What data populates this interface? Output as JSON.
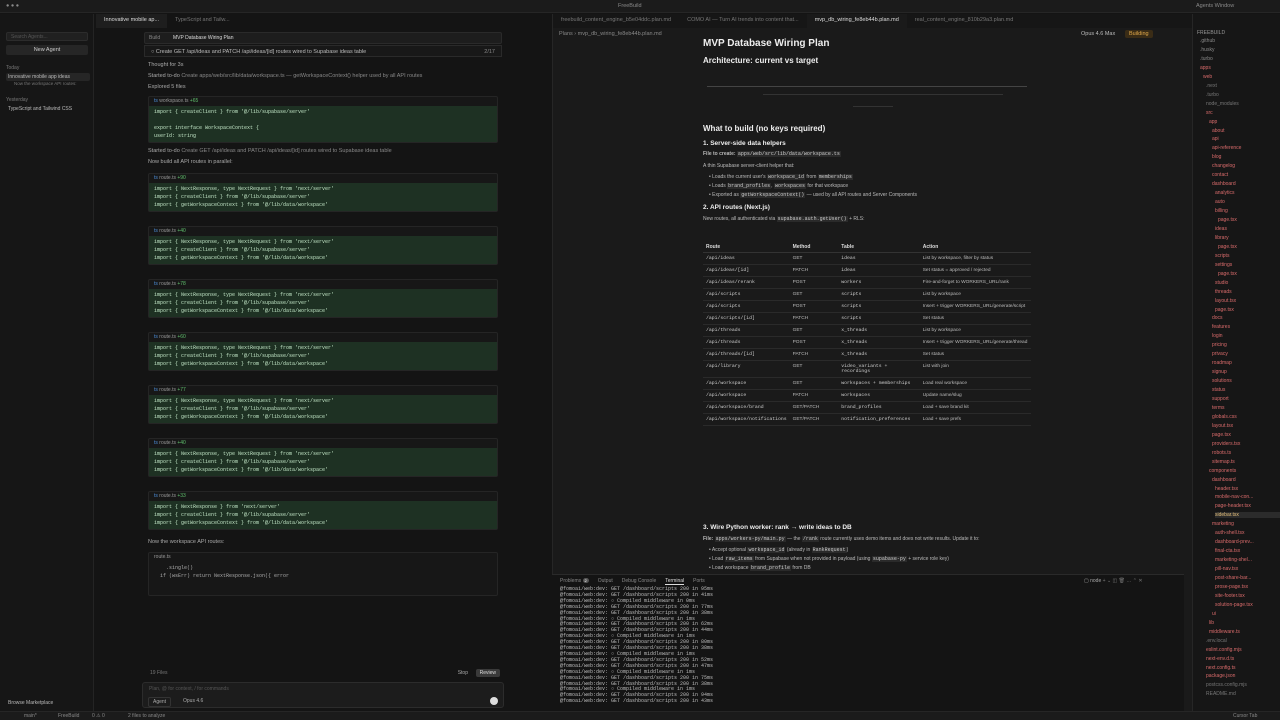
{
  "window": {
    "title": "FreeBuild",
    "right_title": "Agents Window"
  },
  "chat_tabs": [
    {
      "label": "Innovative mobile ap..."
    },
    {
      "label": "TypeScript and Tailw..."
    }
  ],
  "sidebar": {
    "search_placeholder": "Search Agents...",
    "new_agent": "New Agent",
    "today": "Today",
    "item_today": "Innovative mobile app ideas",
    "item_today_sub": "Now the workspace API routes:",
    "yesterday": "Yesterday",
    "item_yesterday": "TypeScript and Tailwind CSS",
    "browse": "Browse Marketplace"
  },
  "chat": {
    "build_label": "Build",
    "plan_title": "MVP Database Wiring Plan",
    "todo_text": "Create GET /api/ideas and PATCH /api/ideas/[id] routes wired to Supabase ideas table",
    "todo_count": "2/17",
    "thought": "Thought for 3s",
    "started1_a": "Started to-do",
    "started1_b": "Create apps/web/src/lib/data/workspace.ts — getWorkspaceContext() helper used by all API routes",
    "explored": "Explored 5 files",
    "started2_a": "Started to-do",
    "started2_b": "Create GET /api/ideas and PATCH /api/ideas/[id] routes wired to Supabase ideas table",
    "parallel": "Now build all API routes in parallel:",
    "workspace_api": "Now the workspace API routes:",
    "files_count": "19 Files",
    "stop": "Stop",
    "review": "Review",
    "composer_placeholder": "Plan, @ for context, / for commands",
    "agent": "Agent",
    "model": "Opus 4.6"
  },
  "cards": [
    {
      "file": "workspace.ts",
      "add": "+65",
      "lines": [
        "import { createClient } from '@/lib/supabase/server'",
        "",
        "export interface WorkspaceContext {",
        "  userId: string"
      ]
    },
    {
      "file": "route.ts",
      "add": "+90",
      "lines": [
        "import { NextResponse, type NextRequest } from 'next/server'",
        "import { createClient } from '@/lib/supabase/server'",
        "import { getWorkspaceContext } from '@/lib/data/workspace'"
      ]
    },
    {
      "file": "route.ts",
      "add": "+40",
      "lines": [
        "import { NextResponse, type NextRequest } from 'next/server'",
        "import { createClient } from '@/lib/supabase/server'",
        "import { getWorkspaceContext } from '@/lib/data/workspace'"
      ]
    },
    {
      "file": "route.ts",
      "add": "+78",
      "lines": [
        "import { NextResponse, type NextRequest } from 'next/server'",
        "import { createClient } from '@/lib/supabase/server'",
        "import { getWorkspaceContext } from '@/lib/data/workspace'"
      ]
    },
    {
      "file": "route.ts",
      "add": "+60",
      "lines": [
        "import { NextResponse, type NextRequest } from 'next/server'",
        "import { createClient } from '@/lib/supabase/server'",
        "import { getWorkspaceContext } from '@/lib/data/workspace'"
      ]
    },
    {
      "file": "route.ts",
      "add": "+77",
      "lines": [
        "import { NextResponse, type NextRequest } from 'next/server'",
        "import { createClient } from '@/lib/supabase/server'",
        "import { getWorkspaceContext } from '@/lib/data/workspace'"
      ]
    },
    {
      "file": "route.ts",
      "add": "+40",
      "lines": [
        "import { NextResponse, type NextRequest } from 'next/server'",
        "import { createClient } from '@/lib/supabase/server'",
        "import { getWorkspaceContext } from '@/lib/data/workspace'"
      ]
    },
    {
      "file": "route.ts",
      "add": "+33",
      "lines": [
        "import { NextResponse } from 'next/server'",
        "import { createClient } from '@/lib/supabase/server'",
        "import { getWorkspaceContext } from '@/lib/data/workspace'"
      ]
    }
  ],
  "last_card": {
    "file": "route.ts",
    "lines": [
      "    .single()",
      "",
      "  if (wsErr) return NextResponse.json({ error"
    ]
  },
  "editor": {
    "tabs": [
      {
        "label": "freebuild_content_engine_b5e04ddc.plan.md"
      },
      {
        "label": "COMO AI — Turn AI trends into content that..."
      },
      {
        "label": "mvp_db_wiring_fe8eb44b.plan.md"
      },
      {
        "label": "real_content_engine_810b29a3.plan.md"
      }
    ],
    "crumb": "Plans  ›  mvp_db_wiring_fe8eb44b.plan.md",
    "model": "Opus 4.6 Max",
    "status": "Building",
    "title": "MVP Database Wiring Plan",
    "h_arch": "Architecture: current vs target",
    "h_build": "What to build (no keys required)",
    "h_1": "1. Server-side data helpers",
    "create_label": "File to create:",
    "create_file": "apps/web/src/lib/data/workspace.ts",
    "thin": "A thin Supabase server-client helper that:",
    "b1a": "Loads the current user's",
    "b1b": "workspace_id",
    "b1c": "from",
    "b1d": "memberships",
    "b2a": "Loads",
    "b2b": "brand_profiles",
    "b2c": ",",
    "b2d": "workspaces",
    "b2e": "for that workspace",
    "b3a": "Exported as",
    "b3b": "getWorkspaceContext()",
    "b3c": "— used by all API routes and Server Components",
    "h_2": "2. API routes (Next.js)",
    "routes_intro_a": "New routes, all authenticated via",
    "routes_intro_b": "supabase.auth.getUser()",
    "routes_intro_c": "+ RLS:",
    "table_headers": [
      "Route",
      "Method",
      "Table",
      "Action"
    ],
    "routes": [
      [
        "/api/ideas",
        "GET",
        "ideas",
        "List by workspace, filter by status"
      ],
      [
        "/api/ideas/[id]",
        "PATCH",
        "ideas",
        "Set status = approved / rejected"
      ],
      [
        "/api/ideas/rerank",
        "POST",
        "workers",
        "Fire-and-forget to WORKERS_URL/rank"
      ],
      [
        "/api/scripts",
        "GET",
        "scripts",
        "List by workspace"
      ],
      [
        "/api/scripts",
        "POST",
        "scripts",
        "Insert + trigger WORKERS_URL/generate/script"
      ],
      [
        "/api/scripts/[id]",
        "PATCH",
        "scripts",
        "Set status"
      ],
      [
        "/api/threads",
        "GET",
        "x_threads",
        "List by workspace"
      ],
      [
        "/api/threads",
        "POST",
        "x_threads",
        "Insert + trigger WORKERS_URL/generate/thread"
      ],
      [
        "/api/threads/[id]",
        "PATCH",
        "x_threads",
        "Set status"
      ],
      [
        "/api/library",
        "GET",
        "video_variants + recordings",
        "List with join"
      ],
      [
        "/api/workspace",
        "GET",
        "workspaces + memberships",
        "Load real workspace"
      ],
      [
        "/api/workspace",
        "PATCH",
        "workspaces",
        "Update name/slug"
      ],
      [
        "/api/workspace/brand",
        "GET/PATCH",
        "brand_profiles",
        "Load + save brand kit"
      ],
      [
        "/api/workspace/notifications",
        "GET/PATCH",
        "notification_preferences",
        "Load + save prefs"
      ]
    ],
    "h_3": "3. Wire Python worker: rank → write ideas to DB",
    "file_label": "File:",
    "file_path": "apps/workers-py/main.py",
    "file_desc_a": "— the",
    "file_desc_b": "/rank",
    "file_desc_c": "route currently uses demo items and does not write results. Update it to:",
    "w1a": "Accept optional",
    "w1b": "workspace_id",
    "w1c": "(already in",
    "w1d": "RankRequest",
    ")": ")",
    "w2a": "Load",
    "w2b": "raw_items",
    "w2c": "from Supabase when not provided in payload (using",
    "w2d": "supabase-py",
    "w2e": "+ service role key)",
    "w3a": "Load workspace",
    "w3b": "brand_profile",
    "w3c": "from DB"
  },
  "terminal": {
    "tabs": [
      "Problems",
      "Output",
      "Debug Console",
      "Terminal",
      "Ports"
    ],
    "problems_count": "2",
    "shell": "node",
    "lines": [
      "@fomoai/web:dev:  GET /dashboard/scripts 200 in 95ms",
      "@fomoai/web:dev:  GET /dashboard/scripts 200 in 41ms",
      "@fomoai/web:dev:  ○ Compiled middleware in 0ms",
      "@fomoai/web:dev:  GET /dashboard/scripts 200 in 77ms",
      "@fomoai/web:dev:  GET /dashboard/scripts 200 in 38ms",
      "@fomoai/web:dev:  ○ Compiled middleware in 1ms",
      "@fomoai/web:dev:  GET /dashboard/scripts 200 in 62ms",
      "@fomoai/web:dev:  GET /dashboard/scripts 200 in 44ms",
      "@fomoai/web:dev:  ○ Compiled middleware in 1ms",
      "@fomoai/web:dev:  GET /dashboard/scripts 200 in 80ms",
      "@fomoai/web:dev:  GET /dashboard/scripts 200 in 38ms",
      "@fomoai/web:dev:  ○ Compiled middleware in 1ms",
      "@fomoai/web:dev:  GET /dashboard/scripts 200 in 52ms",
      "@fomoai/web:dev:  GET /dashboard/scripts 200 in 47ms",
      "@fomoai/web:dev:  ○ Compiled middleware in 1ms",
      "@fomoai/web:dev:  GET /dashboard/scripts 200 in 75ms",
      "@fomoai/web:dev:  GET /dashboard/scripts 200 in 38ms",
      "@fomoai/web:dev:  ○ Compiled middleware in 1ms",
      "@fomoai/web:dev:  GET /dashboard/scripts 200 in 94ms",
      "@fomoai/web:dev:  GET /dashboard/scripts 200 in 43ms"
    ]
  },
  "explorer": {
    "root": "FREEBUILD",
    "items": [
      {
        "n": ".github",
        "d": 1,
        "c": "#8a8a8a"
      },
      {
        "n": ".husky",
        "d": 1,
        "c": "#8a8a8a"
      },
      {
        "n": ".turbo",
        "d": 1,
        "c": "#8a8a8a"
      },
      {
        "n": "apps",
        "d": 1,
        "c": "#d96b6b"
      },
      {
        "n": "web",
        "d": 2,
        "c": "#d96b6b"
      },
      {
        "n": ".next",
        "d": 3,
        "c": "#777"
      },
      {
        "n": ".turbo",
        "d": 3,
        "c": "#777"
      },
      {
        "n": "node_modules",
        "d": 3,
        "c": "#777"
      },
      {
        "n": "src",
        "d": 3,
        "c": "#d96b6b"
      },
      {
        "n": "app",
        "d": 4,
        "c": "#d96b6b"
      },
      {
        "n": "about",
        "d": 5,
        "c": "#d96b6b"
      },
      {
        "n": "api",
        "d": 5,
        "c": "#d96b6b"
      },
      {
        "n": "api-reference",
        "d": 5,
        "c": "#d96b6b"
      },
      {
        "n": "blog",
        "d": 5,
        "c": "#d96b6b"
      },
      {
        "n": "changelog",
        "d": 5,
        "c": "#d96b6b"
      },
      {
        "n": "contact",
        "d": 5,
        "c": "#d96b6b"
      },
      {
        "n": "dashboard",
        "d": 5,
        "c": "#d96b6b"
      },
      {
        "n": "analytics",
        "d": 6,
        "c": "#d96b6b"
      },
      {
        "n": "auto",
        "d": 6,
        "c": "#d96b6b"
      },
      {
        "n": "billing",
        "d": 6,
        "c": "#d96b6b"
      },
      {
        "n": "page.tsx",
        "d": 7,
        "c": "#d96b6b"
      },
      {
        "n": "ideas",
        "d": 6,
        "c": "#d96b6b"
      },
      {
        "n": "library",
        "d": 6,
        "c": "#d96b6b"
      },
      {
        "n": "page.tsx",
        "d": 7,
        "c": "#d96b6b"
      },
      {
        "n": "scripts",
        "d": 6,
        "c": "#d96b6b"
      },
      {
        "n": "settings",
        "d": 6,
        "c": "#d96b6b"
      },
      {
        "n": "page.tsx",
        "d": 7,
        "c": "#d96b6b"
      },
      {
        "n": "studio",
        "d": 6,
        "c": "#d96b6b"
      },
      {
        "n": "threads",
        "d": 6,
        "c": "#d96b6b"
      },
      {
        "n": "layout.tsx",
        "d": 6,
        "c": "#d96b6b"
      },
      {
        "n": "page.tsx",
        "d": 6,
        "c": "#d96b6b"
      },
      {
        "n": "docs",
        "d": 5,
        "c": "#d96b6b"
      },
      {
        "n": "features",
        "d": 5,
        "c": "#d96b6b"
      },
      {
        "n": "login",
        "d": 5,
        "c": "#d96b6b"
      },
      {
        "n": "pricing",
        "d": 5,
        "c": "#d96b6b"
      },
      {
        "n": "privacy",
        "d": 5,
        "c": "#d96b6b"
      },
      {
        "n": "roadmap",
        "d": 5,
        "c": "#d96b6b"
      },
      {
        "n": "signup",
        "d": 5,
        "c": "#d96b6b"
      },
      {
        "n": "solutions",
        "d": 5,
        "c": "#d96b6b"
      },
      {
        "n": "status",
        "d": 5,
        "c": "#d96b6b"
      },
      {
        "n": "support",
        "d": 5,
        "c": "#d96b6b"
      },
      {
        "n": "terms",
        "d": 5,
        "c": "#d96b6b"
      },
      {
        "n": "globals.css",
        "d": 5,
        "c": "#d96b6b"
      },
      {
        "n": "layout.tsx",
        "d": 5,
        "c": "#d96b6b"
      },
      {
        "n": "page.tsx",
        "d": 5,
        "c": "#d96b6b"
      },
      {
        "n": "providers.tsx",
        "d": 5,
        "c": "#d96b6b"
      },
      {
        "n": "robots.ts",
        "d": 5,
        "c": "#d96b6b"
      },
      {
        "n": "sitemap.ts",
        "d": 5,
        "c": "#d96b6b"
      },
      {
        "n": "components",
        "d": 4,
        "c": "#d96b6b"
      },
      {
        "n": "dashboard",
        "d": 5,
        "c": "#d96b6b"
      },
      {
        "n": "header.tsx",
        "d": 6,
        "c": "#d96b6b"
      },
      {
        "n": "mobile-nav-con...",
        "d": 6,
        "c": "#d96b6b"
      },
      {
        "n": "page-header.tsx",
        "d": 6,
        "c": "#d96b6b"
      },
      {
        "n": "sidebar.tsx",
        "d": 6,
        "c": "#e6c07b",
        "sel": true
      },
      {
        "n": "marketing",
        "d": 5,
        "c": "#d96b6b"
      },
      {
        "n": "auth-shell.tsx",
        "d": 6,
        "c": "#d96b6b"
      },
      {
        "n": "dashboard-prev...",
        "d": 6,
        "c": "#d96b6b"
      },
      {
        "n": "final-cta.tsx",
        "d": 6,
        "c": "#d96b6b"
      },
      {
        "n": "marketing-shel...",
        "d": 6,
        "c": "#d96b6b"
      },
      {
        "n": "pill-nav.tsx",
        "d": 6,
        "c": "#d96b6b"
      },
      {
        "n": "post-share-bar...",
        "d": 6,
        "c": "#d96b6b"
      },
      {
        "n": "prose-page.tsx",
        "d": 6,
        "c": "#d96b6b"
      },
      {
        "n": "site-footer.tsx",
        "d": 6,
        "c": "#d96b6b"
      },
      {
        "n": "solution-page.tsx",
        "d": 6,
        "c": "#d96b6b"
      },
      {
        "n": "ui",
        "d": 5,
        "c": "#d96b6b"
      },
      {
        "n": "lib",
        "d": 4,
        "c": "#d96b6b"
      },
      {
        "n": "middleware.ts",
        "d": 4,
        "c": "#d96b6b"
      },
      {
        "n": ".env.local",
        "d": 3,
        "c": "#777"
      },
      {
        "n": "eslint.config.mjs",
        "d": 3,
        "c": "#d96b6b"
      },
      {
        "n": "next-env.d.ts",
        "d": 3,
        "c": "#d96b6b"
      },
      {
        "n": "next.config.ts",
        "d": 3,
        "c": "#d96b6b"
      },
      {
        "n": "package.json",
        "d": 3,
        "c": "#d96b6b"
      },
      {
        "n": "postcss.config.mjs",
        "d": 3,
        "c": "#777"
      },
      {
        "n": "README.md",
        "d": 3,
        "c": "#777"
      }
    ]
  },
  "status": {
    "left": "main*",
    "files": "FreeBuild",
    "problems": "0  ⚠ 0",
    "analyze": "2 files to analyze",
    "right": "Cursor Tab"
  }
}
